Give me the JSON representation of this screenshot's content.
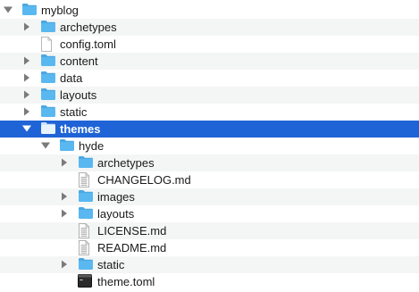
{
  "colors": {
    "folder": "#5ab8f0",
    "folder_tab": "#4aa7e4",
    "selection": "#1f64d6",
    "alt_row": "#f4f5f5"
  },
  "tree": [
    {
      "label": "myblog",
      "level": 0,
      "type": "folder",
      "expanded": true,
      "selected": false,
      "icon": "folder-icon"
    },
    {
      "label": "archetypes",
      "level": 1,
      "type": "folder",
      "expanded": false,
      "selected": false,
      "icon": "folder-icon"
    },
    {
      "label": "config.toml",
      "level": 1,
      "type": "file",
      "selected": false,
      "icon": "toml-file-icon"
    },
    {
      "label": "content",
      "level": 1,
      "type": "folder",
      "expanded": false,
      "selected": false,
      "icon": "folder-icon"
    },
    {
      "label": "data",
      "level": 1,
      "type": "folder",
      "expanded": false,
      "selected": false,
      "icon": "folder-icon"
    },
    {
      "label": "layouts",
      "level": 1,
      "type": "folder",
      "expanded": false,
      "selected": false,
      "icon": "folder-icon"
    },
    {
      "label": "static",
      "level": 1,
      "type": "folder",
      "expanded": false,
      "selected": false,
      "icon": "folder-icon"
    },
    {
      "label": "themes",
      "level": 1,
      "type": "folder",
      "expanded": true,
      "selected": true,
      "icon": "folder-icon"
    },
    {
      "label": "hyde",
      "level": 2,
      "type": "folder",
      "expanded": true,
      "selected": false,
      "icon": "folder-icon"
    },
    {
      "label": "archetypes",
      "level": 3,
      "type": "folder",
      "expanded": false,
      "selected": false,
      "icon": "folder-icon"
    },
    {
      "label": "CHANGELOG.md",
      "level": 3,
      "type": "file",
      "selected": false,
      "icon": "markdown-file-icon"
    },
    {
      "label": "images",
      "level": 3,
      "type": "folder",
      "expanded": false,
      "selected": false,
      "icon": "folder-icon"
    },
    {
      "label": "layouts",
      "level": 3,
      "type": "folder",
      "expanded": false,
      "selected": false,
      "icon": "folder-icon"
    },
    {
      "label": "LICENSE.md",
      "level": 3,
      "type": "file",
      "selected": false,
      "icon": "markdown-file-icon"
    },
    {
      "label": "README.md",
      "level": 3,
      "type": "file",
      "selected": false,
      "icon": "markdown-file-icon"
    },
    {
      "label": "static",
      "level": 3,
      "type": "folder",
      "expanded": false,
      "selected": false,
      "icon": "folder-icon"
    },
    {
      "label": "theme.toml",
      "level": 3,
      "type": "file",
      "selected": false,
      "icon": "terminal-file-icon"
    }
  ]
}
